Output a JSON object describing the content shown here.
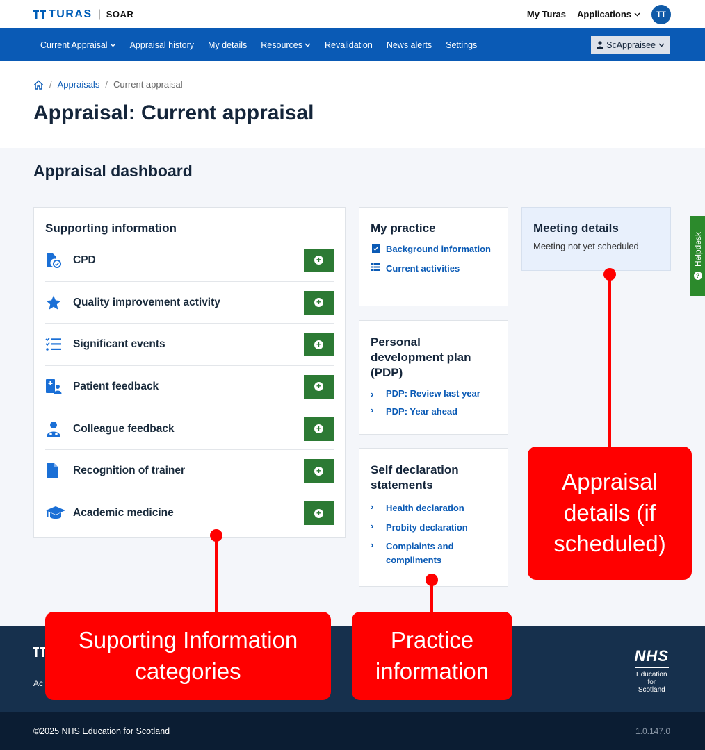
{
  "topbar": {
    "brand_name": "TURAS",
    "brand_separator": "|",
    "product_name": "SOAR",
    "my_turas": "My Turas",
    "applications": "Applications",
    "avatar_initials": "TT"
  },
  "nav": {
    "items": [
      "Current Appraisal",
      "Appraisal history",
      "My details",
      "Resources",
      "Revalidation",
      "News alerts",
      "Settings"
    ],
    "user_button": "ScAppraisee"
  },
  "breadcrumb": {
    "appraisals": "Appraisals",
    "separator": "/",
    "current": "Current appraisal"
  },
  "page_title": "Appraisal: Current appraisal",
  "dashboard": {
    "title": "Appraisal dashboard",
    "supporting_information": {
      "title": "Supporting information",
      "items": [
        {
          "label": "CPD",
          "icon": "cpd-icon"
        },
        {
          "label": "Quality improvement activity",
          "icon": "star-icon"
        },
        {
          "label": "Significant events",
          "icon": "checklist-icon"
        },
        {
          "label": "Patient feedback",
          "icon": "patient-icon"
        },
        {
          "label": "Colleague feedback",
          "icon": "doctor-icon"
        },
        {
          "label": "Recognition of trainer",
          "icon": "document-icon"
        },
        {
          "label": "Academic medicine",
          "icon": "graduation-cap-icon"
        }
      ]
    },
    "my_practice": {
      "title": "My practice",
      "links": [
        "Background information",
        "Current activities"
      ]
    },
    "pdp": {
      "title": "Personal development plan (PDP)",
      "links": [
        "PDP: Review last year",
        "PDP: Year ahead"
      ]
    },
    "self_declaration": {
      "title": "Self declaration statements",
      "links": [
        "Health declaration",
        "Probity declaration",
        "Complaints and compliments"
      ]
    },
    "meeting": {
      "title": "Meeting details",
      "text": "Meeting not yet scheduled"
    }
  },
  "helpdesk": "Helpdesk",
  "footer": {
    "accessibility_partial": "Ac",
    "nhs": "NHS",
    "nhs_line1": "Education",
    "nhs_line2": "for",
    "nhs_line3": "Scotland",
    "copyright": "©2025 NHS Education for Scotland",
    "version": "1.0.147.0"
  },
  "annotations": {
    "supporting": "Suporting Information categories",
    "practice": "Practice information",
    "appraisal": "Appraisal details (if scheduled)"
  },
  "colors": {
    "primary_blue": "#0a5ab5",
    "add_green": "#2c7a34",
    "annotation_red": "#ff0000",
    "footer_navy": "#16304d"
  }
}
